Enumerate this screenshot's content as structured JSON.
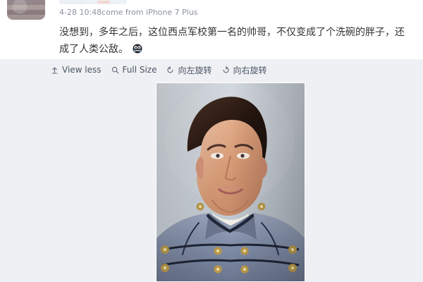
{
  "post": {
    "meta": "4-28 10:48come from iPhone 7 Plus",
    "content_line_1": "没想到，多年之后，这位西点军校第一名的帅哥，不仅变成了个洗碗的胖子，还",
    "content_line_2": "成了人类公敌。"
  },
  "toolbar": {
    "view_less": "View less",
    "full_size": "Full Size",
    "rotate_left": "向左旋转",
    "rotate_right": "向右旋转"
  },
  "icons": {
    "view_less": "arrow-up-icon",
    "full_size": "search-icon",
    "rotate_left": "rotate-left-icon",
    "rotate_right": "rotate-right-icon",
    "emoji": "sad-face-icon"
  },
  "colors": {
    "background": "#eef0f4",
    "card": "#ffffff",
    "meta_text": "#8c939d",
    "body_text": "#333333",
    "toolbar_text": "#4b5563",
    "uniform": "#8f9ab2",
    "uniform_dark": "#5b637a",
    "button_gold": "#b99a4b"
  }
}
